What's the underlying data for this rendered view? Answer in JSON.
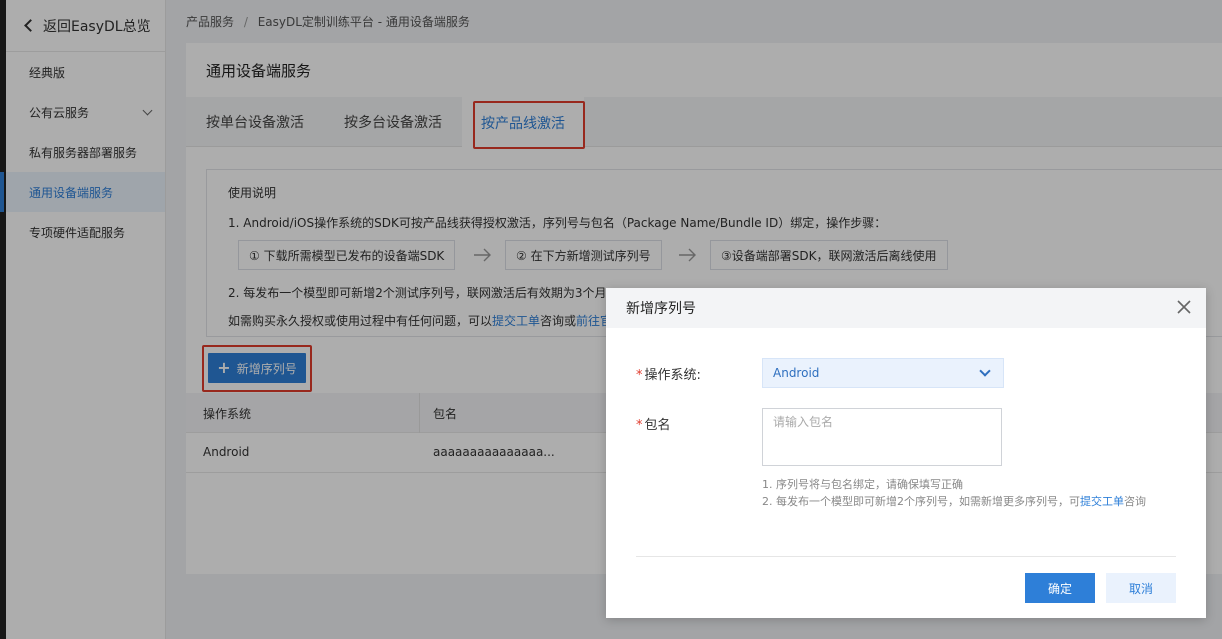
{
  "sidebar": {
    "back_label": "返回EasyDL总览",
    "items": [
      {
        "label": "经典版"
      },
      {
        "label": "公有云服务"
      },
      {
        "label": "私有服务器部署服务"
      },
      {
        "label": "通用设备端服务"
      },
      {
        "label": "专项硬件适配服务"
      }
    ]
  },
  "breadcrumb": {
    "root": "产品服务",
    "separator": "/",
    "current": "EasyDL定制训练平台 - 通用设备端服务"
  },
  "page": {
    "title": "通用设备端服务"
  },
  "tabs": [
    {
      "label": "按单台设备激活"
    },
    {
      "label": "按多台设备激活"
    },
    {
      "label": "按产品线激活"
    }
  ],
  "instructions": {
    "title": "使用说明",
    "line1": "1. Android/iOS操作系统的SDK可按产品线获得授权激活，序列号与包名（Package Name/Bundle ID）绑定，操作步骤：",
    "steps": [
      {
        "label": "① 下载所需模型已发布的设备端SDK"
      },
      {
        "label": "② 在下方新增测试序列号"
      },
      {
        "label": "③设备端部署SDK，联网激活后离线使用"
      }
    ],
    "line2": "2. 每发布一个模型即可新增2个测试序列号，联网激活后有效期为3个月",
    "line3_prefix": "如需购买永久授权或使用过程中有任何问题，可以",
    "line3_link1": "提交工单",
    "line3_mid": "咨询或",
    "line3_link2": "前往官"
  },
  "add_button": {
    "label": "新增序列号"
  },
  "table": {
    "headers": [
      "操作系统",
      "包名"
    ],
    "rows": [
      {
        "os": "Android",
        "package": "aaaaaaaaaaaaaaa..."
      }
    ]
  },
  "modal": {
    "title": "新增序列号",
    "os_label": "操作系统:",
    "os_value": "Android",
    "package_label": "包名",
    "package_placeholder": "请输入包名",
    "hint1": "1. 序列号将与包名绑定，请确保填写正确",
    "hint2_prefix": "2. 每发布一个模型即可新增2个序列号，如需新增更多序列号，可",
    "hint2_link": "提交工单",
    "hint2_suffix": "咨询",
    "ok_label": "确定",
    "cancel_label": "取消"
  },
  "colors": {
    "accent": "#2e7fd8",
    "highlight_box": "#e03b2c"
  }
}
